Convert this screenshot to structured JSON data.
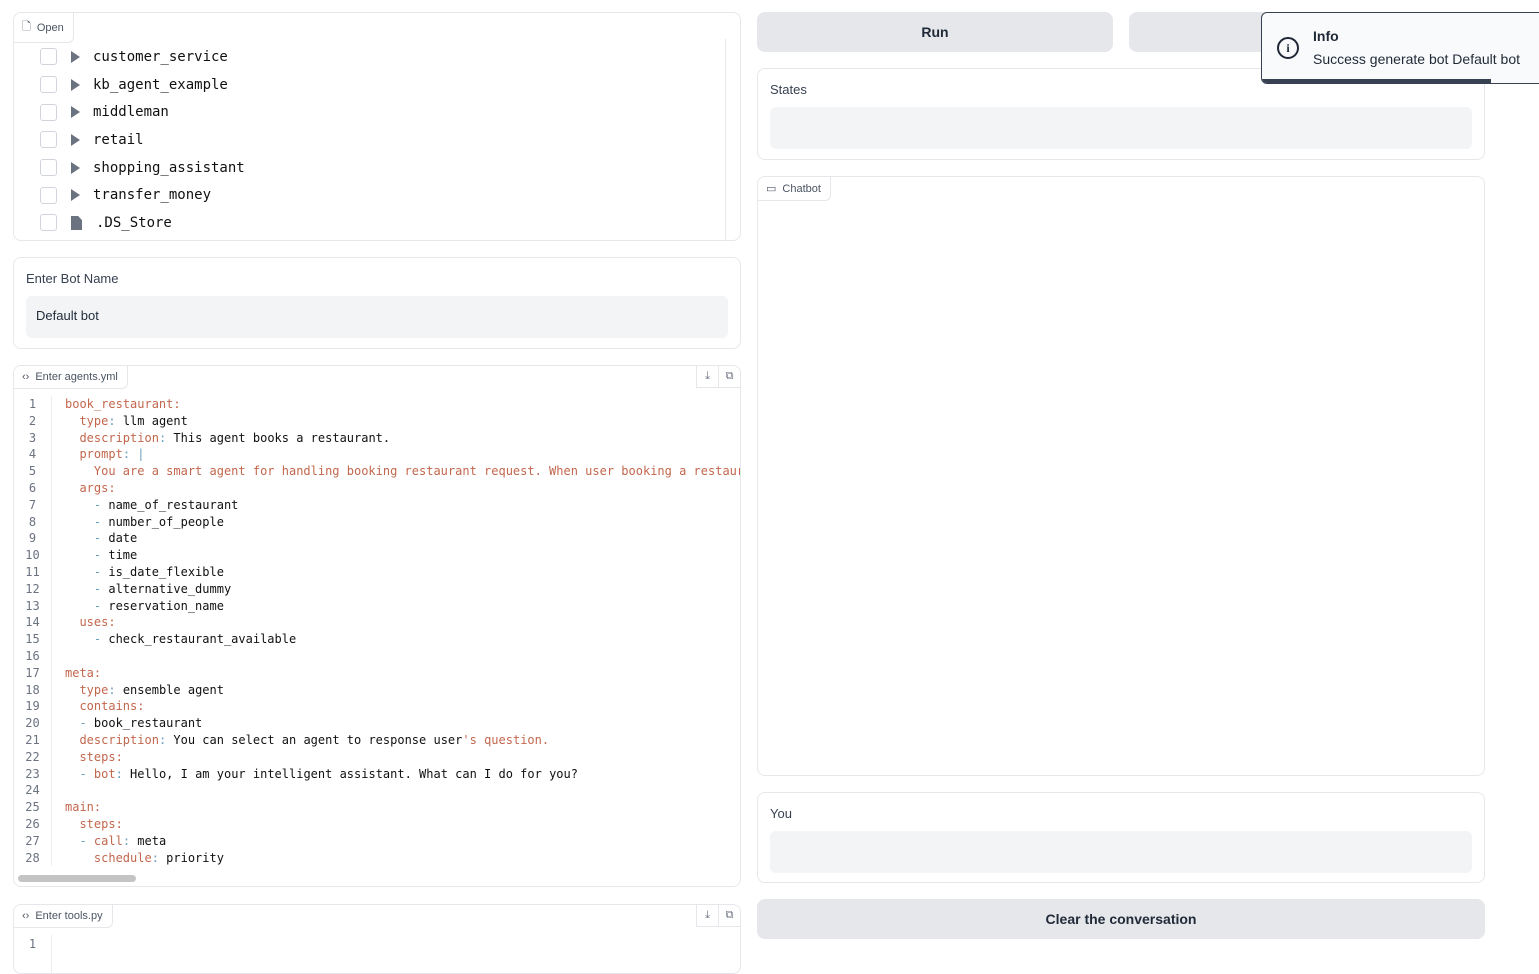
{
  "file_explorer": {
    "tag": "Open",
    "items": [
      {
        "name": "customer_service",
        "type": "folder"
      },
      {
        "name": "kb_agent_example",
        "type": "folder"
      },
      {
        "name": "middleman",
        "type": "folder"
      },
      {
        "name": "retail",
        "type": "folder"
      },
      {
        "name": "shopping_assistant",
        "type": "folder"
      },
      {
        "name": "transfer_money",
        "type": "folder"
      },
      {
        "name": ".DS_Store",
        "type": "file"
      }
    ]
  },
  "bot_name": {
    "label": "Enter Bot Name",
    "value": "Default bot"
  },
  "agents_editor": {
    "tag": "Enter agents.yml",
    "lines": [
      "book_restaurant:",
      "  type: llm agent",
      "  description: This agent books a restaurant.",
      "  prompt: |",
      "    You are a smart agent for handling booking restaurant request. When user booking a restaurant",
      "  args:",
      "    - name_of_restaurant",
      "    - number_of_people",
      "    - date",
      "    - time",
      "    - is_date_flexible",
      "    - alternative_dummy",
      "    - reservation_name",
      "  uses:",
      "    - check_restaurant_available",
      "",
      "meta:",
      "  type: ensemble agent",
      "  contains:",
      "  - book_restaurant",
      "  description: You can select an agent to response user's question.",
      "  steps:",
      "  - bot: Hello, I am your intelligent assistant. What can I do for you?",
      "",
      "main:",
      "  steps:",
      "  - call: meta",
      "    schedule: priority"
    ]
  },
  "tools_editor": {
    "tag": "Enter tools.py",
    "lines": [
      ""
    ]
  },
  "run_button": "Run",
  "states": {
    "label": "States",
    "value": ""
  },
  "chatbot": {
    "tag": "Chatbot"
  },
  "you": {
    "label": "You",
    "value": ""
  },
  "clear_button": "Clear the conversation",
  "toast": {
    "title": "Info",
    "message": "Success generate bot Default bot",
    "icon": "info-icon"
  },
  "colors": {
    "key": "#c2674d",
    "button": "#e5e7eb",
    "toast_bar": "#374151"
  }
}
